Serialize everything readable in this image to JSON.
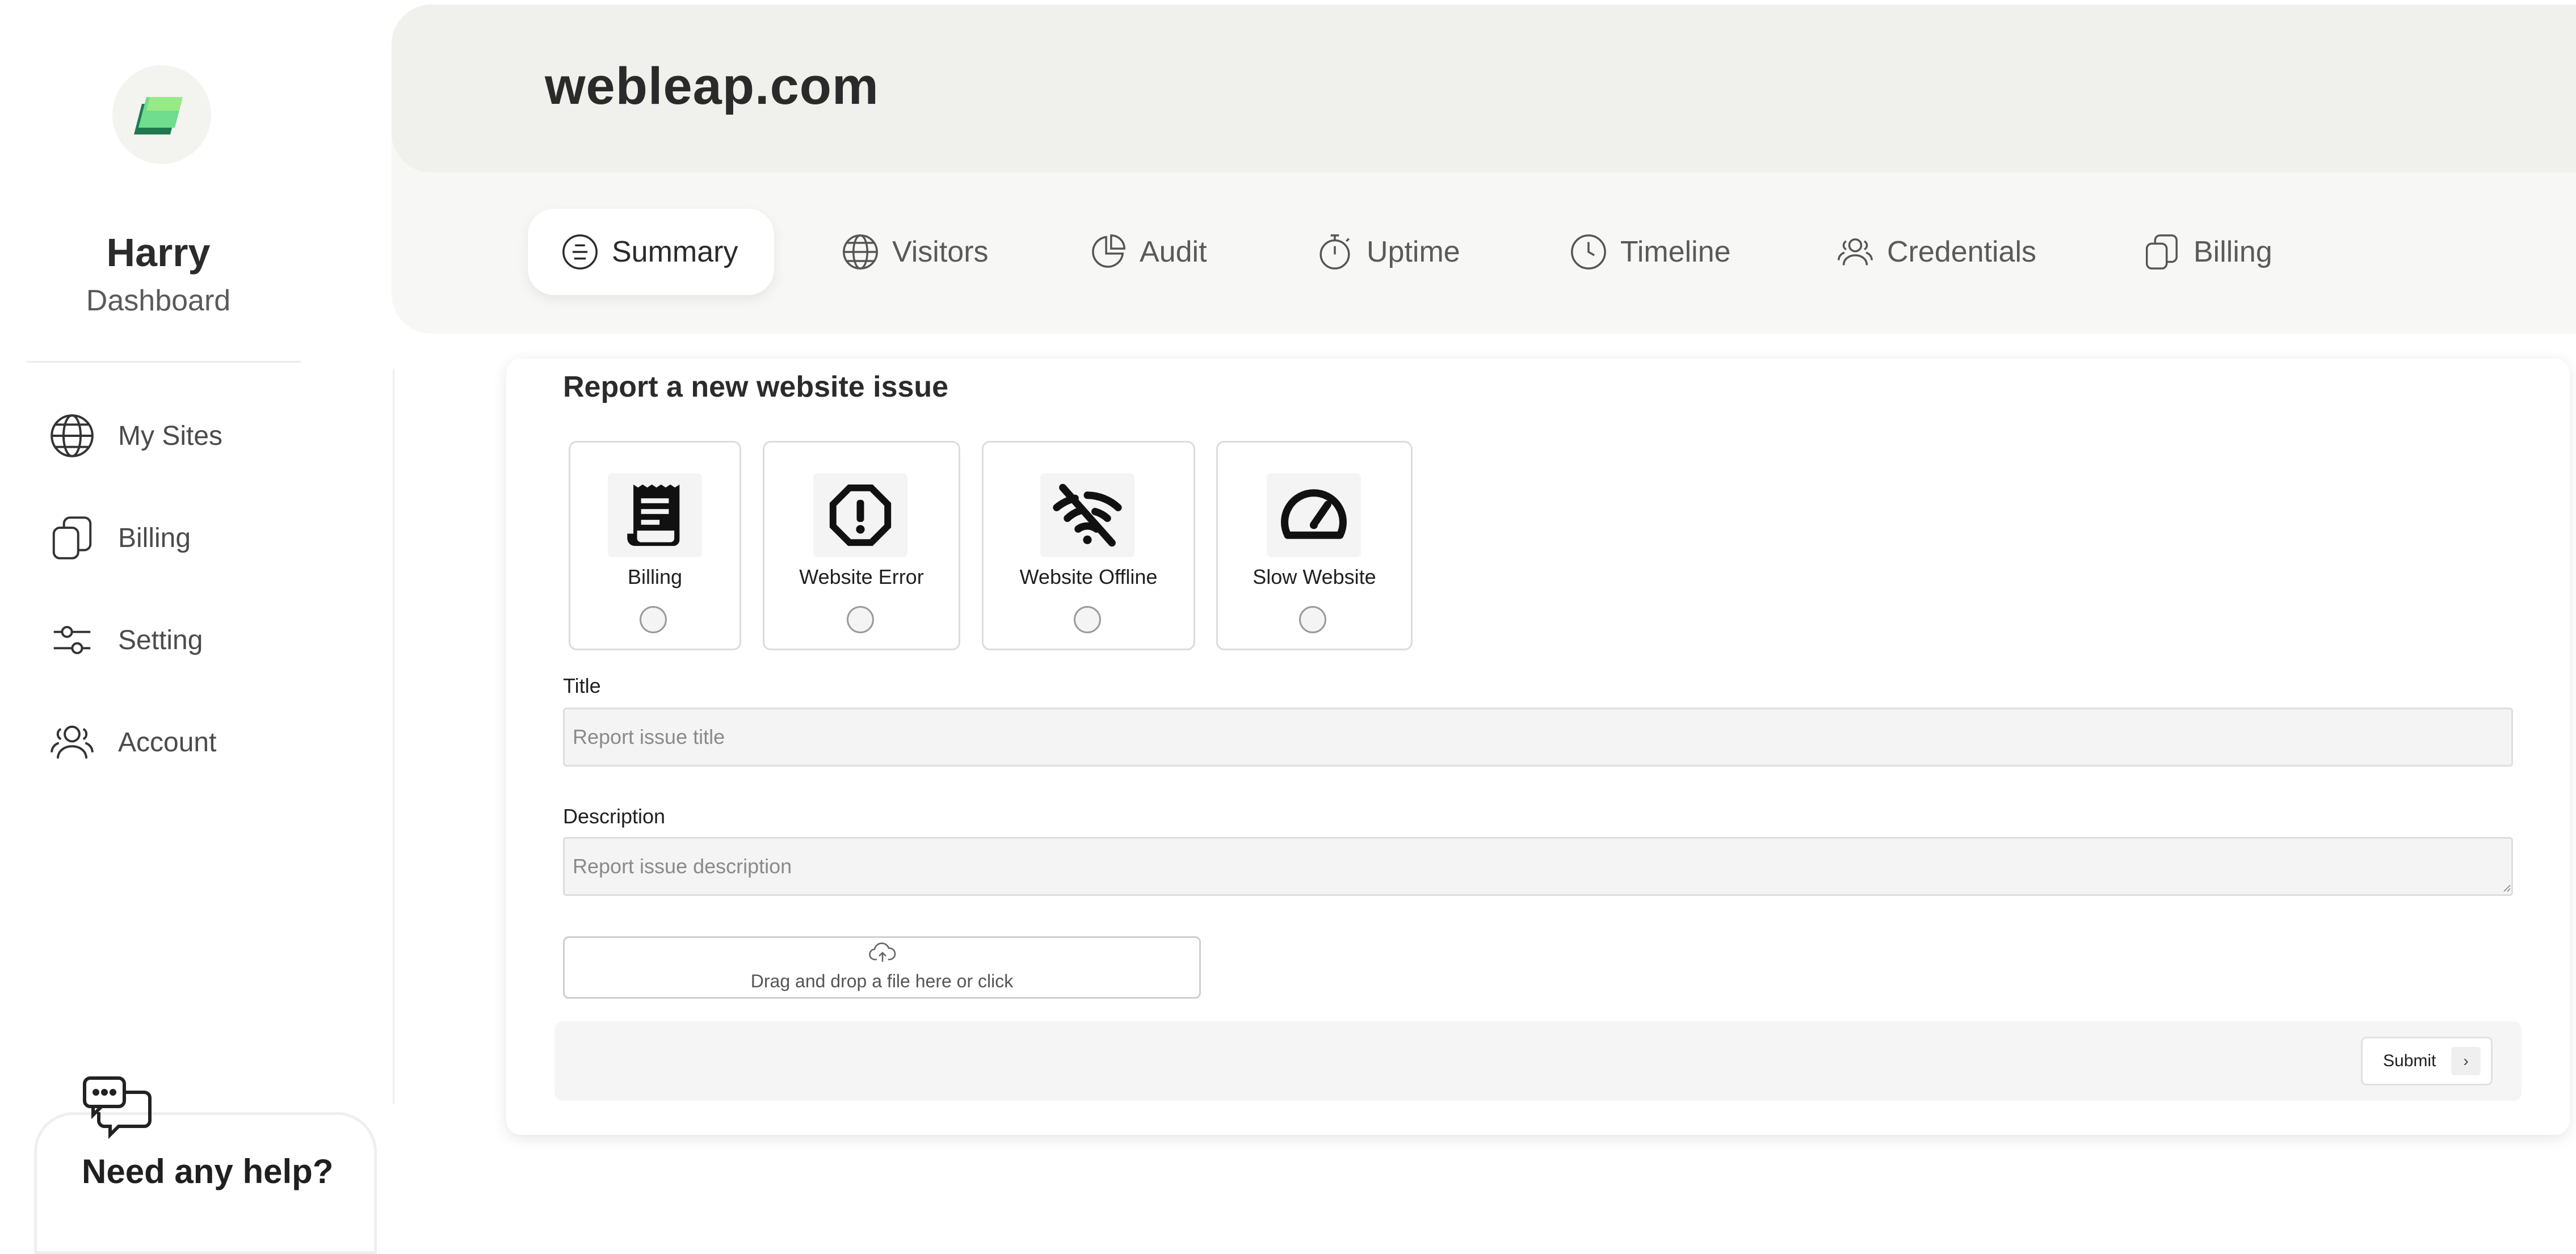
{
  "sidebar": {
    "user_name": "Harry",
    "user_role": "Dashboard",
    "items": [
      {
        "label": "My Sites",
        "icon": "globe-icon"
      },
      {
        "label": "Billing",
        "icon": "copy-icon"
      },
      {
        "label": "Setting",
        "icon": "sliders-icon"
      },
      {
        "label": "Account",
        "icon": "users-icon"
      }
    ],
    "help": {
      "title": "Need any help?",
      "icon": "chat-bubbles-icon"
    }
  },
  "header": {
    "site_title": "webleap.com",
    "active_tab": "Summary",
    "tabs": [
      {
        "label": "Summary",
        "icon": "list-circle-icon"
      },
      {
        "label": "Visitors",
        "icon": "globe-icon"
      },
      {
        "label": "Audit",
        "icon": "pie-chart-icon"
      },
      {
        "label": "Uptime",
        "icon": "stopwatch-icon"
      },
      {
        "label": "Timeline",
        "icon": "clock-icon"
      },
      {
        "label": "Credentials",
        "icon": "users-icon"
      },
      {
        "label": "Billing",
        "icon": "copy-icon"
      }
    ]
  },
  "form": {
    "title": "Report a new website issue",
    "issue_types": [
      {
        "label": "Billing",
        "icon": "receipt-icon",
        "selected": false
      },
      {
        "label": "Website Error",
        "icon": "alert-octagon-icon",
        "selected": false
      },
      {
        "label": "Website Offline",
        "icon": "wifi-off-icon",
        "selected": false
      },
      {
        "label": "Slow Website",
        "icon": "speedometer-icon",
        "selected": false
      }
    ],
    "title_field": {
      "label": "Title",
      "placeholder": "Report issue title",
      "value": ""
    },
    "description_field": {
      "label": "Description",
      "placeholder": "Report issue description",
      "value": ""
    },
    "dropzone": {
      "text": "Drag and drop a file here or click",
      "icon": "cloud-upload-icon"
    },
    "submit": {
      "label": "Submit",
      "chevron": "›"
    }
  },
  "colors": {
    "logo_green": "#52c77a",
    "logo_dark": "#1f7a50",
    "header_top": "#f0f0ec",
    "header_bottom": "#f7f7f5"
  }
}
